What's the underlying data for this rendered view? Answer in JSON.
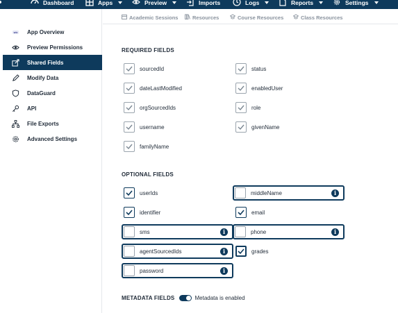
{
  "topnav": {
    "items": [
      {
        "label": "Dashboard",
        "icon": "dashboard-icon"
      },
      {
        "label": "Apps",
        "icon": "grid-icon",
        "dropdown": true
      },
      {
        "label": "Preview",
        "icon": "eye-icon",
        "dropdown": true
      },
      {
        "label": "Imports",
        "icon": "import-icon"
      },
      {
        "label": "Logs",
        "icon": "clock-icon",
        "dropdown": true
      },
      {
        "label": "Reports",
        "icon": "document-icon",
        "dropdown": true
      },
      {
        "label": "Settings",
        "icon": "gear-icon",
        "dropdown": true
      }
    ]
  },
  "sidebar": {
    "items": [
      {
        "label": "App Overview",
        "icon": "app-logo-icon"
      },
      {
        "label": "Preview Permissions",
        "icon": "eye-icon"
      },
      {
        "label": "Shared Fields",
        "icon": "share-icon",
        "active": true
      },
      {
        "label": "Modify Data",
        "icon": "pencil-icon"
      },
      {
        "label": "DataGuard",
        "icon": "shield-icon"
      },
      {
        "label": "API",
        "icon": "key-icon"
      },
      {
        "label": "File Exports",
        "icon": "sitemap-icon"
      },
      {
        "label": "Advanced Settings",
        "icon": "gear-icon"
      }
    ]
  },
  "tabs": {
    "items": [
      {
        "label": "Academic Sessions",
        "icon": "calendar-icon"
      },
      {
        "label": "Resources",
        "icon": "books-icon"
      },
      {
        "label": "Course Resources",
        "icon": "course-icon"
      },
      {
        "label": "Class Resources",
        "icon": "class-icon"
      }
    ]
  },
  "required": {
    "title": "REQUIRED FIELDS",
    "fields": [
      {
        "label": "sourcedId",
        "checked": true
      },
      {
        "label": "status",
        "checked": true
      },
      {
        "label": "dateLastModified",
        "checked": true
      },
      {
        "label": "enabledUser",
        "checked": true
      },
      {
        "label": "orgSourcedIds",
        "checked": true
      },
      {
        "label": "role",
        "checked": true
      },
      {
        "label": "username",
        "checked": true
      },
      {
        "label": "givenName",
        "checked": true
      },
      {
        "label": "familyName",
        "checked": true
      }
    ]
  },
  "optional": {
    "title": "OPTIONAL FIELDS",
    "fields": [
      {
        "label": "userIds",
        "checked": true,
        "boxed": false
      },
      {
        "label": "middleName",
        "checked": false,
        "boxed": true,
        "info": "i"
      },
      {
        "label": "identifier",
        "checked": true,
        "boxed": false
      },
      {
        "label": "email",
        "checked": true,
        "boxed": false
      },
      {
        "label": "sms",
        "checked": false,
        "boxed": true,
        "info": "i"
      },
      {
        "label": "phone",
        "checked": false,
        "boxed": true,
        "info": "i"
      },
      {
        "label": "agentSourcedIds",
        "checked": false,
        "boxed": true,
        "info": "i"
      },
      {
        "label": "grades",
        "checked": true,
        "boxed": true
      },
      {
        "label": "password",
        "checked": false,
        "boxed": true,
        "info": "i"
      }
    ]
  },
  "metadata": {
    "title": "METADATA FIELDS",
    "toggle_label": "Metadata is enabled",
    "enabled": true
  },
  "colors": {
    "primary": "#0e3a5c",
    "muted": "#8a939e"
  }
}
